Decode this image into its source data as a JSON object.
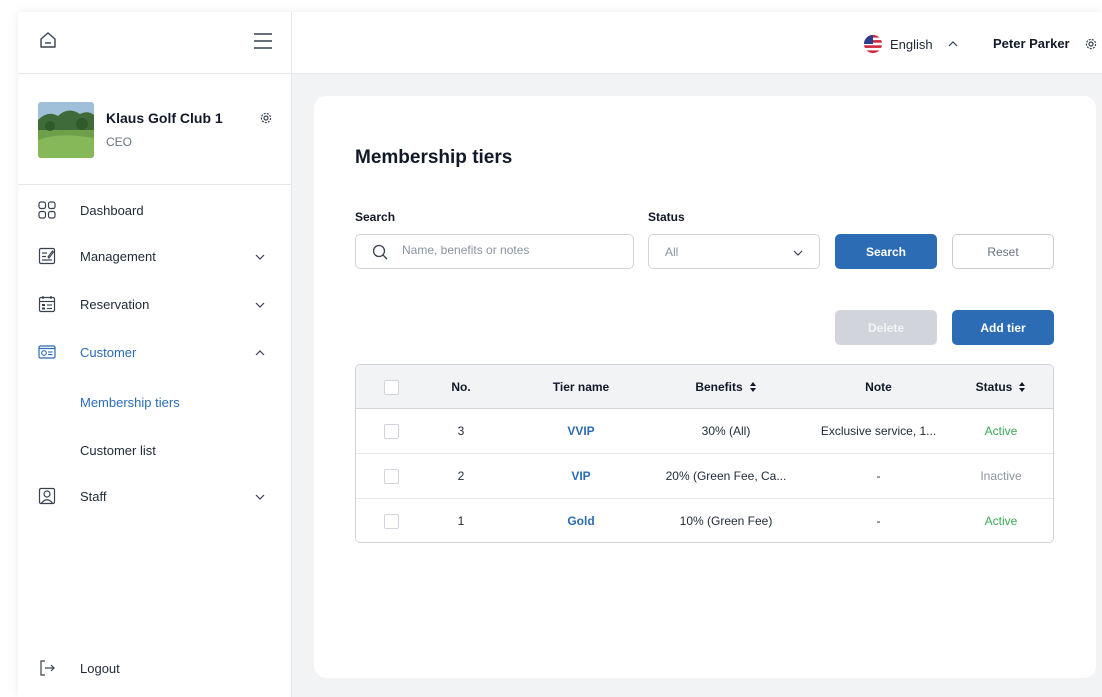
{
  "sidebar": {
    "club_name": "Klaus Golf Club 1",
    "club_role": "CEO",
    "items": [
      {
        "label": "Dashboard",
        "icon": "dashboard-icon"
      },
      {
        "label": "Management",
        "icon": "management-icon"
      },
      {
        "label": "Reservation",
        "icon": "calendar-icon"
      },
      {
        "label": "Customer",
        "icon": "customer-card-icon"
      },
      {
        "label": "Staff",
        "icon": "staff-icon"
      }
    ],
    "sub_items": [
      "Membership tiers",
      "Customer list"
    ],
    "logout": "Logout"
  },
  "topbar": {
    "language": "English",
    "user_name": "Peter Parker"
  },
  "page": {
    "title": "Membership tiers",
    "search_label": "Search",
    "search_placeholder": "Name, benefits or notes",
    "status_label": "Status",
    "status_value": "All",
    "search_button": "Search",
    "reset_button": "Reset",
    "delete_button": "Delete",
    "add_button": "Add tier"
  },
  "table": {
    "headers": [
      "No.",
      "Tier name",
      "Benefits",
      "Note",
      "Status"
    ],
    "rows": [
      {
        "no": "3",
        "tier": "VVIP",
        "benefits": "30% (All)",
        "note": "Exclusive service, 1...",
        "status": "Active"
      },
      {
        "no": "2",
        "tier": "VIP",
        "benefits": "20% (Green Fee, Ca...",
        "note": "-",
        "status": "Inactive"
      },
      {
        "no": "1",
        "tier": "Gold",
        "benefits": "10% (Green Fee)",
        "note": "-",
        "status": "Active"
      }
    ]
  },
  "colors": {
    "accent": "#2b6cb5",
    "active": "#3aa855",
    "inactive": "#8b93a1"
  }
}
